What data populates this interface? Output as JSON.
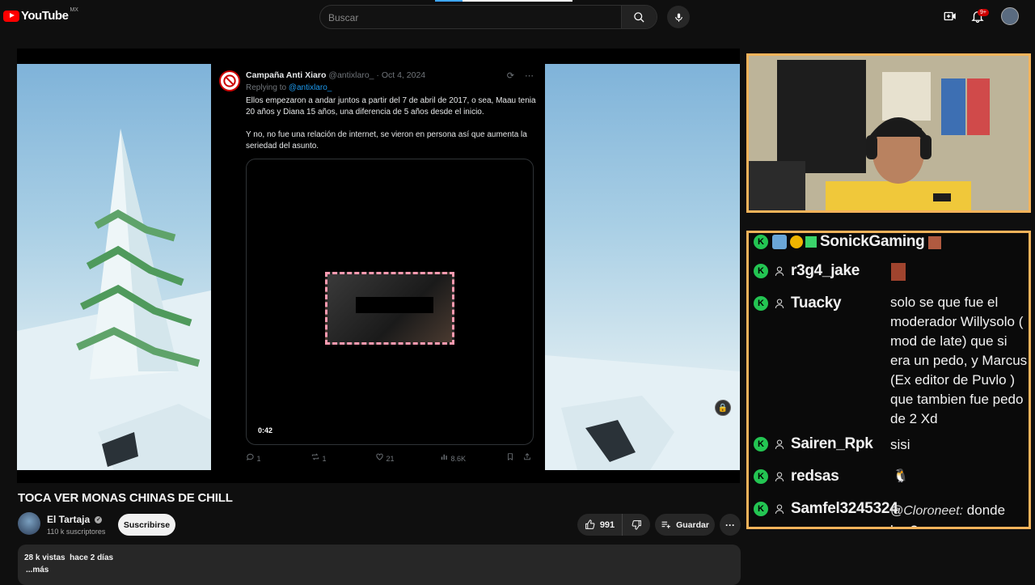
{
  "header": {
    "logo_text": "YouTube",
    "region": "MX",
    "search_placeholder": "Buscar",
    "notifications": "9+"
  },
  "tweet": {
    "name": "Campaña Anti Xiaro",
    "handle": "@antixlaro_",
    "date": "Oct 4, 2024",
    "replying_prefix": "Replying to",
    "replying_handle": "@antixlaro_",
    "paragraph1": "Ellos empezaron a andar juntos a partir del 7 de abril de 2017, o sea, Maau tenia 20 años y Diana 15 años, una diferencia de 5 años desde el inicio.",
    "paragraph2": "Y no, no fue una relación de internet, se vieron en persona así que aumenta la seriedad del asunto.",
    "duration": "0:42",
    "replies": "1",
    "reposts": "1",
    "likes": "21",
    "views": "8.6K"
  },
  "chat": {
    "messages": [
      {
        "user": "SonickGaming",
        "text": ""
      },
      {
        "user": "r3g4_jake",
        "text": ""
      },
      {
        "user": "Tuacky",
        "text": "solo se que fue el moderador Willysolo ( mod de late) que si era un pedo, y Marcus (Ex editor de Puvlo ) que tambien fue pedo de 2 Xd"
      },
      {
        "user": "Sairen_Rpk",
        "text": "sisi"
      },
      {
        "user": "redsas",
        "text": ""
      },
      {
        "user": "Samfel3245324",
        "mention": "@Cloroneet:",
        "text": "donde bro?"
      }
    ]
  },
  "video": {
    "title": "TOCA VER MONAS CHINAS DE CHILL",
    "channel_name": "El Tartaja",
    "subscribers": "110 k suscriptores",
    "subscribe_label": "Suscribirse",
    "like_count": "991",
    "save_label": "Guardar",
    "views_date": "28 k vistas  hace 2 días",
    "more_label": "...más"
  }
}
